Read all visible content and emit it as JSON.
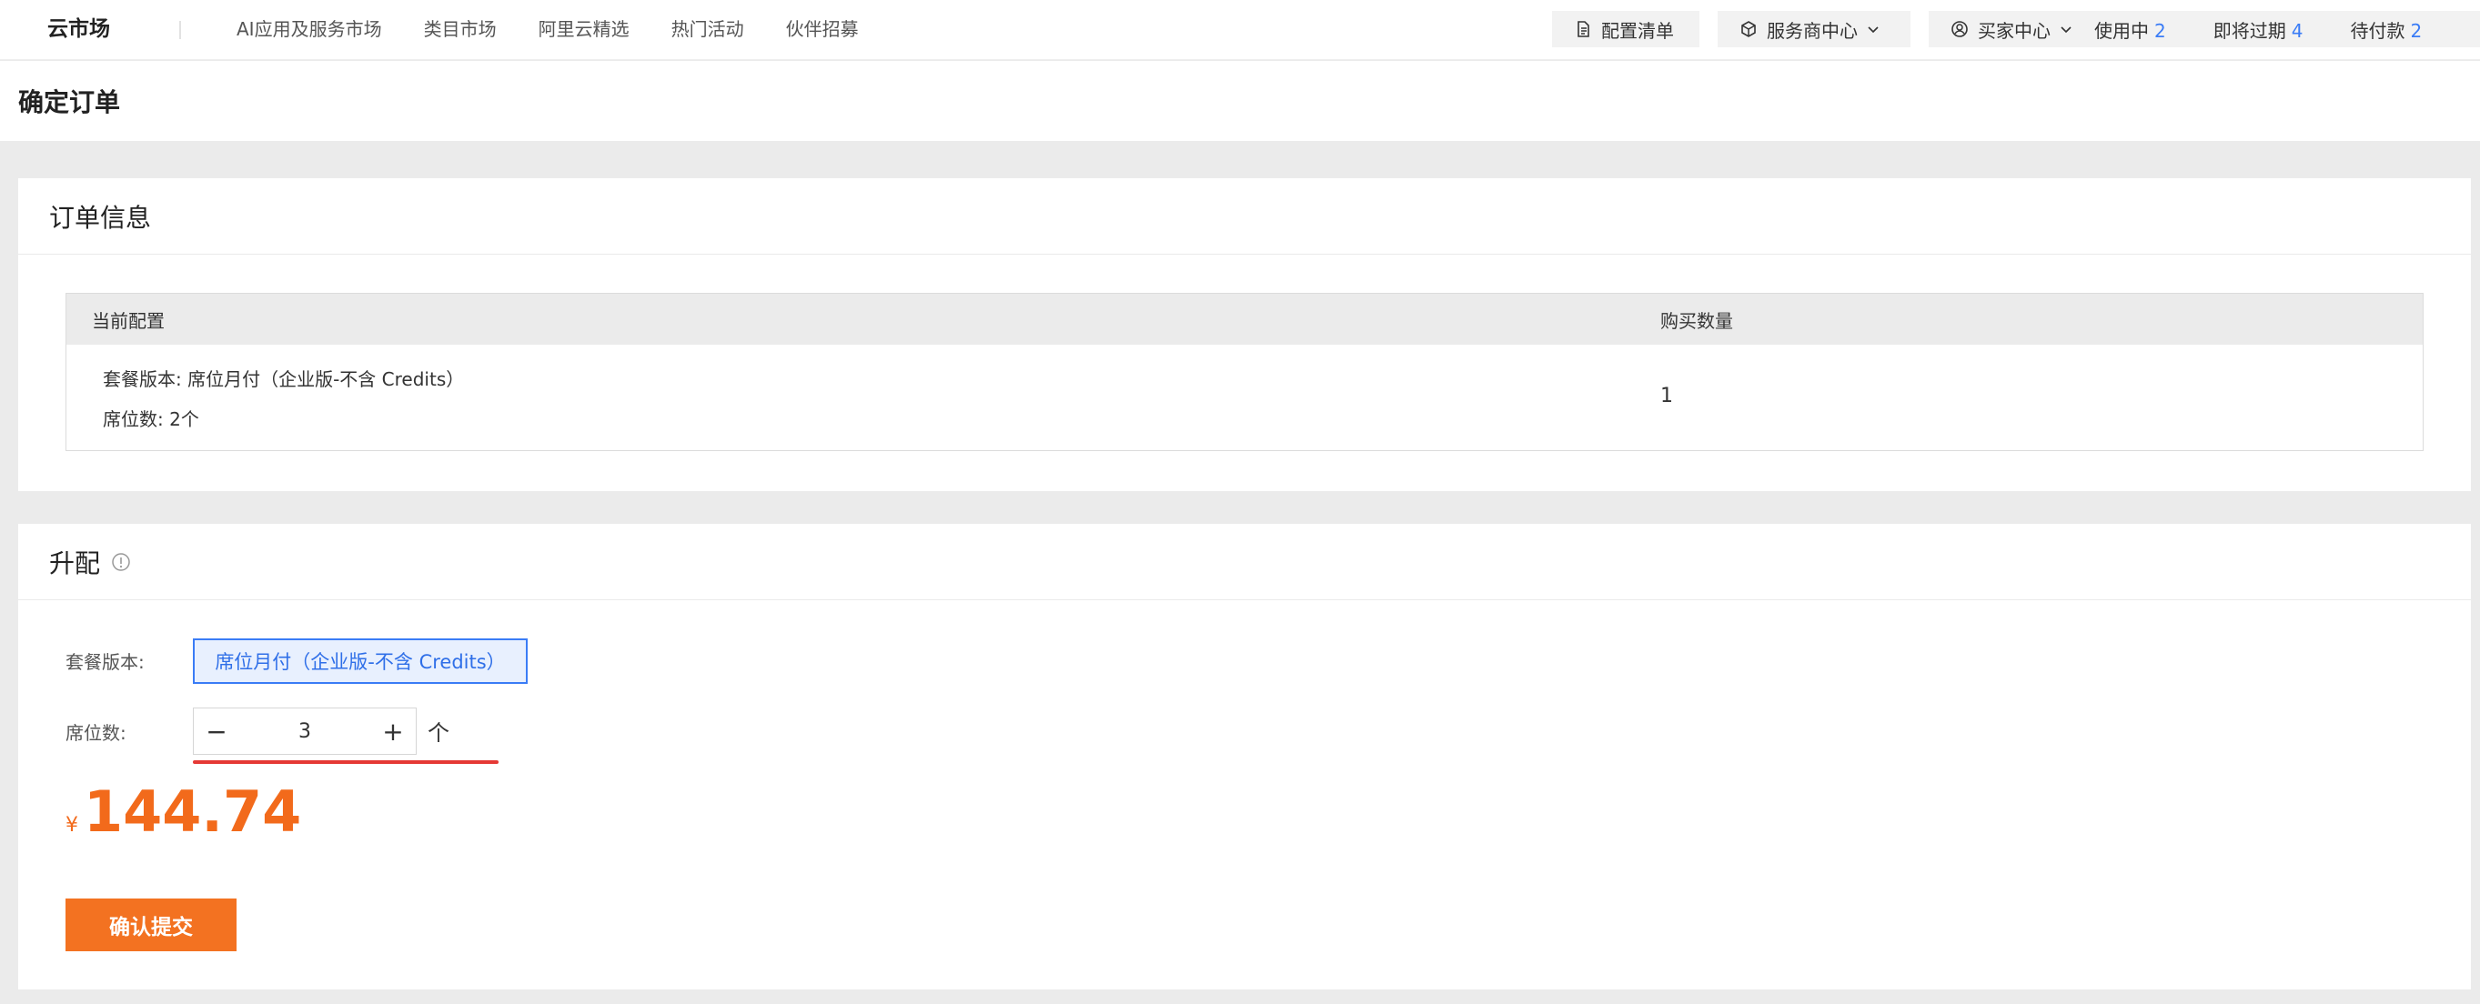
{
  "nav": {
    "brand": "云市场",
    "links": [
      "AI应用及服务市场",
      "类目市场",
      "阿里云精选",
      "热门活动",
      "伙伴招募"
    ],
    "config_list": "配置清单",
    "provider_center": "服务商中心",
    "buyer_center": "买家中心",
    "in_use_label": "使用中",
    "in_use_count": "2",
    "expiring_label": "即将过期",
    "expiring_count": "4",
    "pending_label": "待付款",
    "pending_count": "2"
  },
  "page": {
    "title": "确定订单"
  },
  "order": {
    "heading": "订单信息",
    "columns": [
      "当前配置",
      "购买数量"
    ],
    "config_line1": "套餐版本: 席位月付（企业版-不含 Credits）",
    "config_line2": "席位数: 2个",
    "quantity": "1"
  },
  "upgrade": {
    "heading": "升配",
    "plan_label": "套餐版本:",
    "plan_option": "席位月付（企业版-不含 Credits）",
    "seats_label": "席位数:",
    "seats_minus": "−",
    "seats_value": "3",
    "seats_plus": "+",
    "seats_unit": "个",
    "currency": "¥",
    "price": "144.74",
    "submit": "确认提交"
  },
  "colors": {
    "accent_blue": "#3a7cf6",
    "price_orange": "#f26a1b",
    "button_orange": "#f37221",
    "underline_red": "#e53935"
  }
}
